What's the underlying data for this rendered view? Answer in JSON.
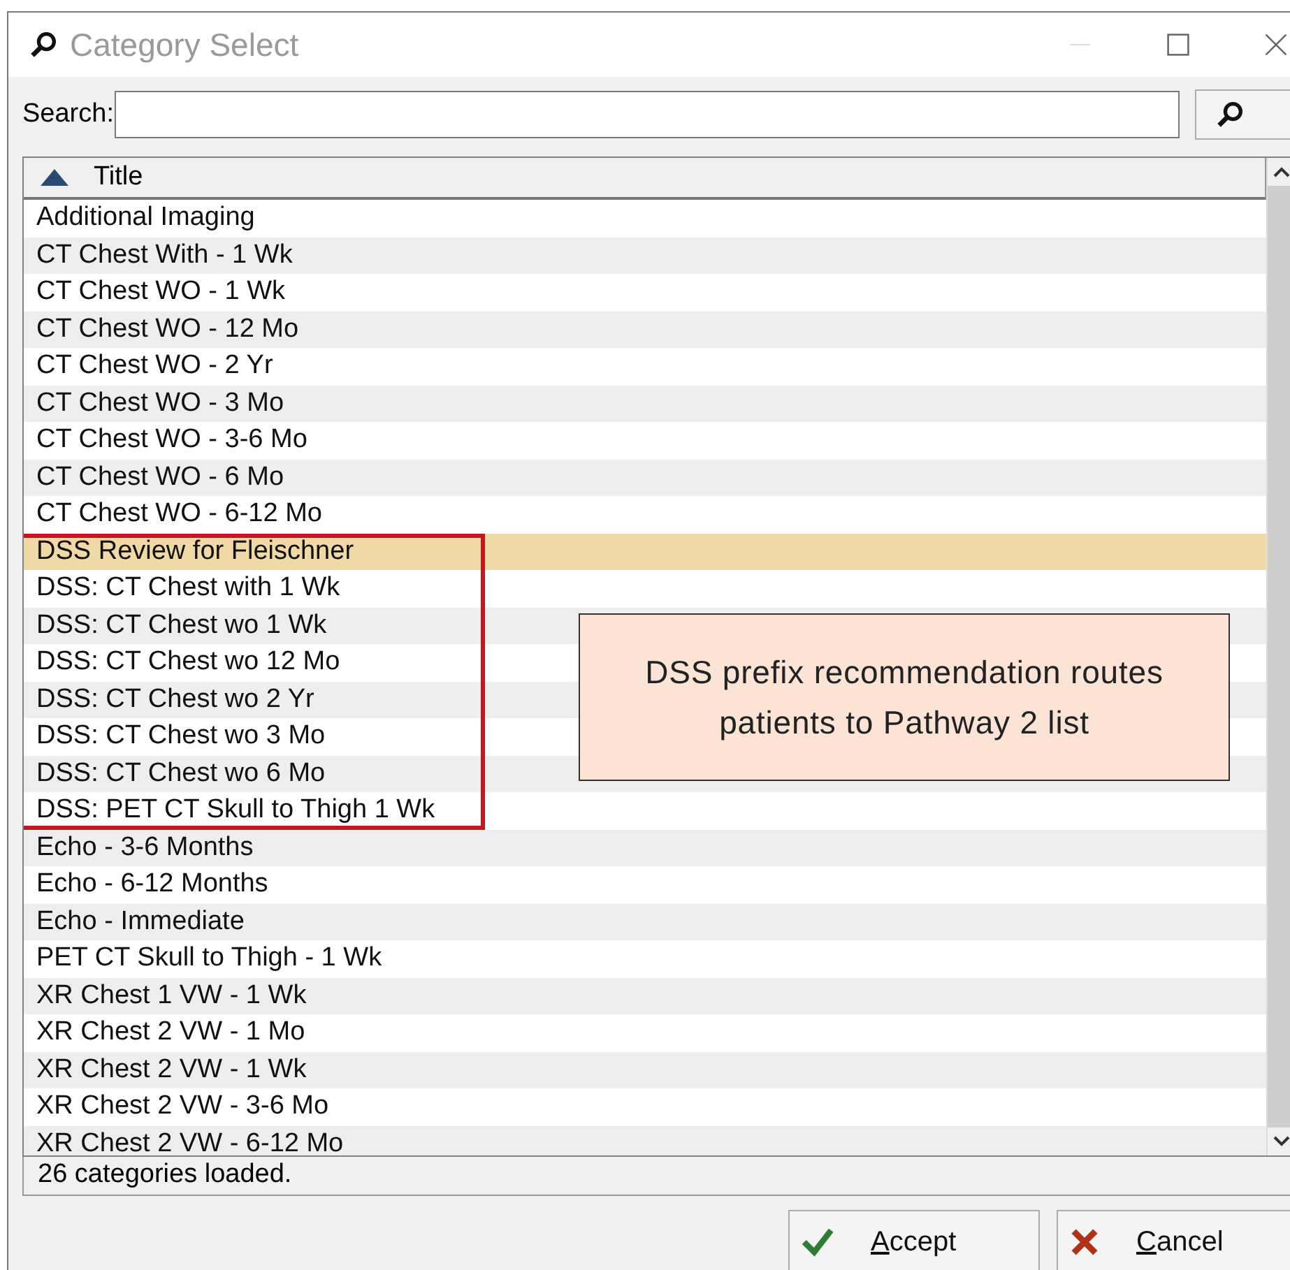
{
  "window": {
    "title": "Category Select"
  },
  "search": {
    "label": "Search:"
  },
  "table": {
    "columns": [
      {
        "label": "Title",
        "sort_ascending": true
      }
    ],
    "rows": [
      {
        "title": "Additional Imaging",
        "selected": false,
        "boxed": false
      },
      {
        "title": "CT Chest With - 1 Wk",
        "selected": false,
        "boxed": false
      },
      {
        "title": "CT Chest WO - 1 Wk",
        "selected": false,
        "boxed": false
      },
      {
        "title": "CT Chest WO - 12 Mo",
        "selected": false,
        "boxed": false
      },
      {
        "title": "CT Chest WO - 2 Yr",
        "selected": false,
        "boxed": false
      },
      {
        "title": "CT Chest WO - 3 Mo",
        "selected": false,
        "boxed": false
      },
      {
        "title": "CT Chest WO - 3-6 Mo",
        "selected": false,
        "boxed": false
      },
      {
        "title": "CT Chest WO - 6 Mo",
        "selected": false,
        "boxed": false
      },
      {
        "title": "CT Chest WO - 6-12 Mo",
        "selected": false,
        "boxed": false
      },
      {
        "title": "DSS Review for Fleischner",
        "selected": true,
        "boxed": true
      },
      {
        "title": "DSS: CT Chest with 1 Wk",
        "selected": false,
        "boxed": true
      },
      {
        "title": "DSS: CT Chest wo 1 Wk",
        "selected": false,
        "boxed": true
      },
      {
        "title": "DSS: CT Chest wo 12 Mo",
        "selected": false,
        "boxed": true
      },
      {
        "title": "DSS: CT Chest wo 2 Yr",
        "selected": false,
        "boxed": true
      },
      {
        "title": "DSS: CT Chest wo 3 Mo",
        "selected": false,
        "boxed": true
      },
      {
        "title": "DSS: CT Chest wo 6 Mo",
        "selected": false,
        "boxed": true
      },
      {
        "title": "DSS: PET CT Skull to Thigh 1 Wk",
        "selected": false,
        "boxed": true
      },
      {
        "title": "Echo - 3-6 Months",
        "selected": false,
        "boxed": false
      },
      {
        "title": "Echo - 6-12 Months",
        "selected": false,
        "boxed": false
      },
      {
        "title": "Echo - Immediate",
        "selected": false,
        "boxed": false
      },
      {
        "title": "PET CT Skull to Thigh - 1 Wk",
        "selected": false,
        "boxed": false
      },
      {
        "title": "XR Chest 1 VW - 1 Wk",
        "selected": false,
        "boxed": false
      },
      {
        "title": "XR Chest 2 VW - 1 Mo",
        "selected": false,
        "boxed": false
      },
      {
        "title": "XR Chest 2 VW - 1 Wk",
        "selected": false,
        "boxed": false
      },
      {
        "title": "XR Chest 2 VW - 3-6 Mo",
        "selected": false,
        "boxed": false
      },
      {
        "title": "XR Chest 2 VW - 6-12 Mo",
        "selected": false,
        "boxed": false
      }
    ]
  },
  "callout": {
    "text": "DSS prefix recommendation routes patients to Pathway 2 list"
  },
  "status_bar": "26 categories loaded.",
  "buttons": [
    {
      "label": "Accept",
      "kind": "accept"
    },
    {
      "label": "Cancel",
      "kind": "cancel"
    }
  ]
}
